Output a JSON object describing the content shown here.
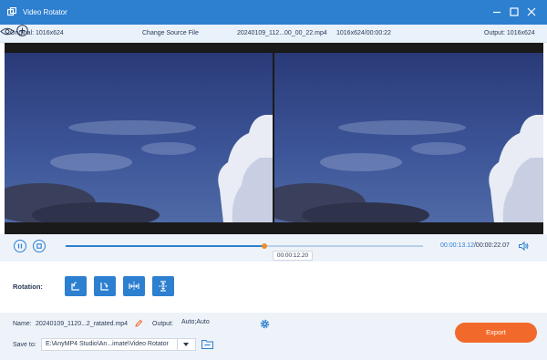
{
  "window": {
    "title": "Video Rotator"
  },
  "infobar": {
    "original": "Original: 1016x624",
    "change_source": "Change Source File",
    "filename": "20240109_112...00_00_22.mp4",
    "meta": "1016x624/00:00:22",
    "output": "Output: 1016x624"
  },
  "playback": {
    "progress_fraction": 0.5567,
    "hover_time": "00:00:12.20",
    "current_time": "00:00:13.12",
    "total_time": "/00:00:22.07"
  },
  "rotation": {
    "label": "Rotation:",
    "buttons": [
      "rotate-left",
      "rotate-right",
      "flip-horizontal",
      "flip-vertical"
    ]
  },
  "export": {
    "name_label": "Name:",
    "name_value": "20240109_1120...2_ratated.mp4",
    "output_label": "Output:",
    "output_value": "Auto;Auto",
    "save_label": "Save to:",
    "save_path": "E:\\AnyMP4 Studio\\An...imate\\Video Rotator",
    "export_button": "Export"
  },
  "colors": {
    "accent": "#2d7fd0",
    "export": "#f26a2b",
    "knob": "#f08b2b"
  }
}
